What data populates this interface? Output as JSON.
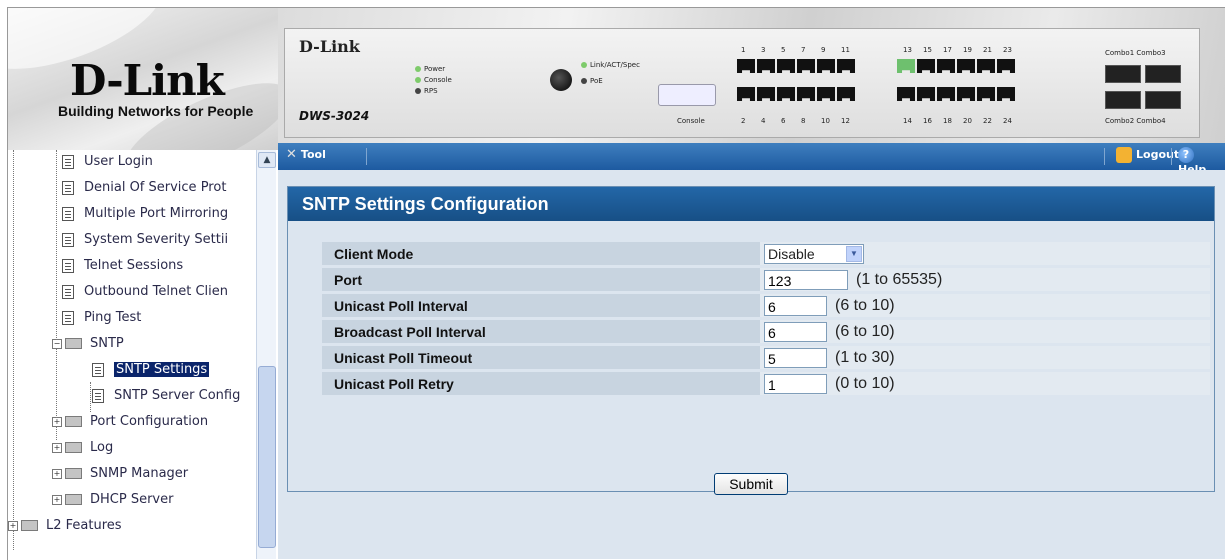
{
  "header": {
    "brand": "D-Link",
    "tagline": "Building Networks for People",
    "device_logo": "D-Link",
    "device_model": "DWS-3024",
    "leds": [
      "Power",
      "Console",
      "RPS",
      "Link/ACT/Spec",
      "PoE"
    ],
    "console_label": "Console",
    "port_numbers_top": [
      "1",
      "3",
      "5",
      "7",
      "9",
      "11",
      "13",
      "15",
      "17",
      "19",
      "21",
      "23"
    ],
    "port_numbers_bottom": [
      "2",
      "4",
      "6",
      "8",
      "10",
      "12",
      "14",
      "16",
      "18",
      "20",
      "22",
      "24"
    ],
    "combo_top": "Combo1 Combo3",
    "combo_bottom": "Combo2 Combo4"
  },
  "toolbar": {
    "tool_label": "Tool",
    "logout_label": "Logout",
    "help_label": "Help"
  },
  "nav": {
    "items": [
      {
        "label": "User Login",
        "type": "doc"
      },
      {
        "label": "Denial Of Service Prot",
        "type": "doc"
      },
      {
        "label": "Multiple Port Mirroring",
        "type": "doc"
      },
      {
        "label": "System Severity Settii",
        "type": "doc"
      },
      {
        "label": "Telnet Sessions",
        "type": "doc"
      },
      {
        "label": "Outbound Telnet Clien",
        "type": "doc"
      },
      {
        "label": "Ping Test",
        "type": "doc"
      },
      {
        "label": "SNTP",
        "type": "folder-open"
      },
      {
        "label": "SNTP Settings",
        "type": "doc",
        "selected": true
      },
      {
        "label": "SNTP Server Config",
        "type": "doc"
      },
      {
        "label": "Port Configuration",
        "type": "folder"
      },
      {
        "label": "Log",
        "type": "folder"
      },
      {
        "label": "SNMP Manager",
        "type": "folder"
      },
      {
        "label": "DHCP Server",
        "type": "folder"
      },
      {
        "label": "L2 Features",
        "type": "folder"
      }
    ]
  },
  "form": {
    "title": "SNTP Settings Configuration",
    "client_mode": {
      "label": "Client Mode",
      "value": "Disable"
    },
    "port": {
      "label": "Port",
      "value": "123",
      "range": "(1 to 65535)"
    },
    "unicast_poll_interval": {
      "label": "Unicast Poll Interval",
      "value": "6",
      "range": "(6 to 10)"
    },
    "broadcast_poll_interval": {
      "label": "Broadcast Poll Interval",
      "value": "6",
      "range": "(6 to 10)"
    },
    "unicast_poll_timeout": {
      "label": "Unicast Poll Timeout",
      "value": "5",
      "range": "(1 to 30)"
    },
    "unicast_poll_retry": {
      "label": "Unicast Poll Retry",
      "value": "1",
      "range": "(0 to 10)"
    },
    "submit_label": "Submit"
  },
  "colors": {
    "title_bar": "#1d5aa0",
    "panel_bg": "#dce5ef",
    "selected_item": "#0a246a"
  }
}
